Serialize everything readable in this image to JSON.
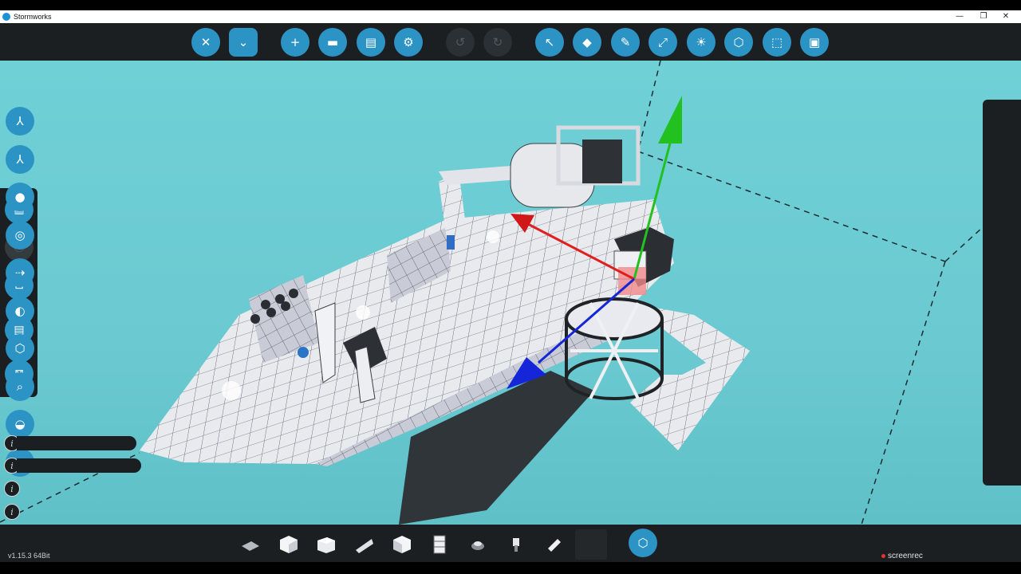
{
  "window": {
    "title": "Stormworks",
    "controls": {
      "minimize": "—",
      "maximize": "❐",
      "close": "✕"
    }
  },
  "top_toolbar": {
    "buttons": [
      {
        "name": "close-editor",
        "icon": "close-circle-icon",
        "glyph": "✕",
        "enabled": true
      },
      {
        "name": "vehicle-menu",
        "icon": "dropdown-box-icon",
        "glyph": "⌄",
        "enabled": true
      },
      {
        "name": "new-vehicle",
        "icon": "plus-icon",
        "glyph": "+",
        "enabled": true
      },
      {
        "name": "open-vehicle",
        "icon": "folder-icon",
        "glyph": "▬",
        "enabled": true
      },
      {
        "name": "save-vehicle",
        "icon": "floppy-disk-icon",
        "glyph": "▤",
        "enabled": true
      },
      {
        "name": "steam-workshop",
        "icon": "steam-icon",
        "glyph": "⚙",
        "enabled": true
      },
      {
        "name": "undo",
        "icon": "undo-icon",
        "glyph": "↺",
        "enabled": false
      },
      {
        "name": "redo",
        "icon": "redo-icon",
        "glyph": "↻",
        "enabled": false
      },
      {
        "name": "select-tool",
        "icon": "cursor-arrow-icon",
        "glyph": "↖",
        "enabled": true
      },
      {
        "name": "erase-tool",
        "icon": "eraser-icon",
        "glyph": "◆",
        "enabled": true
      },
      {
        "name": "paint-tool",
        "icon": "paint-brush-icon",
        "glyph": "✎",
        "enabled": true
      },
      {
        "name": "move-tool",
        "icon": "axis-arrows-icon",
        "glyph": "⤢",
        "enabled": true
      },
      {
        "name": "lighting-tool",
        "icon": "light-bulb-icon",
        "glyph": "☀",
        "enabled": true
      },
      {
        "name": "logic-tool",
        "icon": "logic-box-icon",
        "glyph": "⬡",
        "enabled": true
      },
      {
        "name": "selection-box",
        "icon": "dashed-square-icon",
        "glyph": "⬚",
        "enabled": true
      },
      {
        "name": "microcontroller",
        "icon": "chip-icon",
        "glyph": "▣",
        "enabled": true
      }
    ]
  },
  "left_panel": {
    "buttons": [
      {
        "name": "toggle-panels",
        "icon": "panels-icon",
        "glyph": "▥",
        "enabled": true
      },
      {
        "name": "location",
        "icon": "map-pin-icon",
        "glyph": "⦿",
        "enabled": false
      },
      {
        "name": "focus-selection",
        "icon": "focus-frame-icon",
        "glyph": "⊡",
        "enabled": true
      },
      {
        "name": "save-selection",
        "icon": "floppy-disk-icon",
        "glyph": "▤",
        "enabled": true
      },
      {
        "name": "clear-selection",
        "icon": "cross-frame-icon",
        "glyph": "⊠",
        "enabled": true
      }
    ]
  },
  "right_panel": {
    "buttons": [
      {
        "name": "view-axis-a",
        "icon": "tri-axis-icon",
        "glyph": "⅄"
      },
      {
        "name": "view-axis-b",
        "icon": "tri-axis-icon",
        "glyph": "⅄"
      },
      {
        "name": "camera",
        "icon": "camera-icon",
        "glyph": "●"
      },
      {
        "name": "center-view",
        "icon": "target-circle-icon",
        "glyph": "◎"
      },
      {
        "name": "export",
        "icon": "arrow-right-icon",
        "glyph": "⇢"
      },
      {
        "name": "mass-center",
        "icon": "center-of-mass-icon",
        "glyph": "◐"
      },
      {
        "name": "block-view",
        "icon": "cube-icon",
        "glyph": "⬡"
      },
      {
        "name": "inspect",
        "icon": "magnifier-icon",
        "glyph": "⌕"
      },
      {
        "name": "buoyancy",
        "icon": "buoyancy-icon",
        "glyph": "◒"
      },
      {
        "name": "warnings",
        "icon": "warning-triangle-icon",
        "glyph": "▲"
      }
    ]
  },
  "info_rows": [
    {
      "glyph": "i",
      "has_bar": true
    },
    {
      "glyph": "i",
      "has_bar": true
    },
    {
      "glyph": "i",
      "has_bar": false
    },
    {
      "glyph": "i",
      "has_bar": false
    }
  ],
  "bottom_bar": {
    "version": "v1.15.3 64Bit",
    "hotbar": [
      "wedge-block-icon",
      "cube-block-icon",
      "slope-block-icon",
      "ramp-block-icon",
      "cube-block-icon",
      "pipe-block-icon",
      "button-component-icon",
      "lever-component-icon",
      "sensor-component-icon",
      "empty-slot"
    ],
    "spawn_glyph": "⬡",
    "recorder_label": "screenrec"
  },
  "colors": {
    "accent": "#2c93c5",
    "panel": "#1c1f21",
    "sky": "#6fd0d6",
    "axis_x": "#e01f1f",
    "axis_y": "#22c11f",
    "axis_z": "#1426d8"
  }
}
